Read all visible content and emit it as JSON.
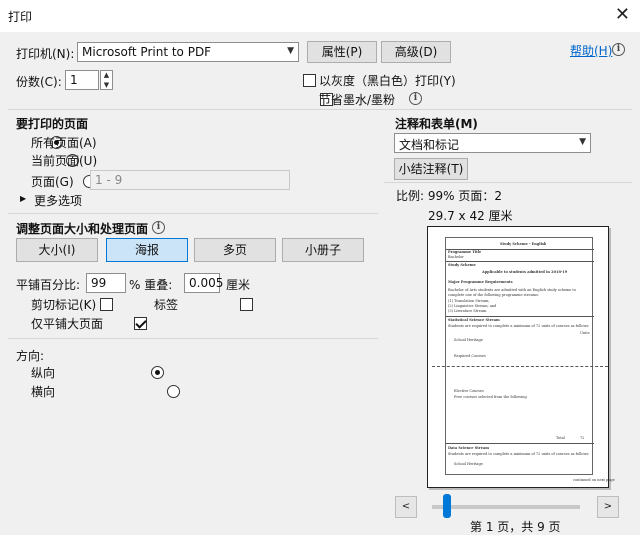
{
  "window": {
    "title": "打印",
    "close_glyph": "✕"
  },
  "printer": {
    "label": "打印机(N):",
    "selected": "Microsoft Print to PDF",
    "properties_btn": "属性(P)",
    "advanced_btn": "高级(D)",
    "help_link": "帮助(H)"
  },
  "copies": {
    "label": "份数(C):",
    "value": "1"
  },
  "options": {
    "grayscale": {
      "label": "以灰度（黑白色）打印(Y)",
      "checked": false
    },
    "save_ink": {
      "label": "节省墨水/墨粉",
      "checked": false
    }
  },
  "pages_to_print": {
    "heading": "要打印的页面",
    "all": "所有页面(A)",
    "current": "当前页面(U)",
    "pages": "页面(G)",
    "range_placeholder": "1 - 9",
    "more": "更多选项",
    "selected": "all"
  },
  "sizing": {
    "heading": "调整页面大小和处理页面",
    "tabs": [
      "大小(I)",
      "海报",
      "多页",
      "小册子"
    ],
    "active_tab": 1,
    "tile_scale_label": "平铺百分比:",
    "tile_scale_value": "99",
    "overlap_label": "% 重叠:",
    "overlap_value": "0.005",
    "overlap_unit": "厘米",
    "cut_marks": {
      "label": "剪切标记(K)",
      "checked": false
    },
    "labels": {
      "label": "标签",
      "checked": false
    },
    "tile_large_only": {
      "label": "仅平铺大页面",
      "checked": true
    }
  },
  "orientation": {
    "heading": "方向:",
    "portrait": "纵向",
    "landscape": "横向",
    "selected": "portrait"
  },
  "comments": {
    "heading": "注释和表单(M)",
    "selected": "文档和标记",
    "summarize_btn": "小结注释(T)"
  },
  "preview": {
    "scale_text": "比例:   99% 页面：2",
    "size_text": "29.7 x 42 厘米",
    "page_indicator": "第 1 页，共 9 页",
    "slider_position": 0.08,
    "doc": {
      "title": "Study Scheme - English",
      "programme_title_label": "Programme Title",
      "programme_title_value": "Bachelor",
      "study_scheme_label": "Study Scheme",
      "applicable": "Applicable to students admitted in 2018-19",
      "major_req": "Major Programme Requirements",
      "para1": "Bachelor of Arts students are admitted with an English study scheme to",
      "para2": "complete one of the following programme streams:",
      "list1": "(1) Translation Stream;",
      "list2": "(2) Linguistics Stream; and",
      "list3": "(3) Literature Stream.",
      "stat_head": "Statistical Science Stream",
      "stat_sub": "Students are required to complete a minimum of 72 units of courses as follows:",
      "units_label": "Units",
      "item1": "School Heritage",
      "item2": "Required Courses",
      "item3": "Elective Courses",
      "item4": "Free courses selected from the following",
      "total": "Total",
      "total_value": "72",
      "data_head": "Data Science Stream",
      "data_sub": "Students are required to complete a minimum of 72 units of courses as follows:",
      "footer": "continued on next page"
    }
  },
  "icons": {
    "combo_arrow": "chevron-down-icon",
    "info": "info-icon",
    "expand": "triangle-right-icon",
    "prev": "chevron-left-icon",
    "next": "chevron-right-icon"
  },
  "colors": {
    "accent": "#0078d7",
    "link": "#0066cc",
    "background": "#f0f0f0"
  }
}
